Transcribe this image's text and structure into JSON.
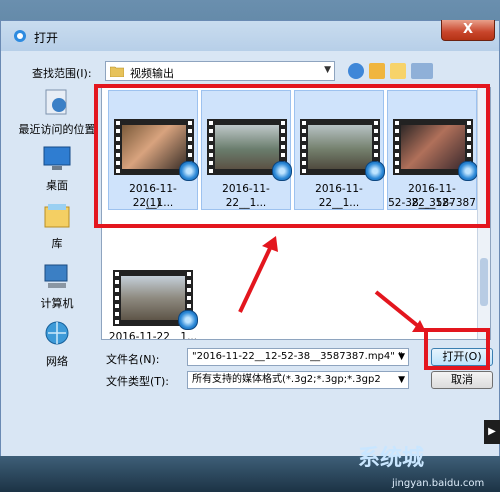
{
  "dialog": {
    "title": "打开",
    "close_glyph": "X"
  },
  "lookin": {
    "label": "查找范围(I):",
    "value": "视频输出"
  },
  "nav": [
    {
      "label": "最近访问的位置",
      "icon": "recent-places-icon"
    },
    {
      "label": "桌面",
      "icon": "desktop-icon"
    },
    {
      "label": "库",
      "icon": "libraries-icon"
    },
    {
      "label": "计算机",
      "icon": "computer-icon"
    },
    {
      "label": "网络",
      "icon": "network-icon"
    }
  ],
  "files": [
    {
      "line1": "2016-11-22__1...",
      "line2": "(1)",
      "selected": true
    },
    {
      "line1": "2016-11-22__1...",
      "line2": "",
      "selected": true
    },
    {
      "line1": "2016-11-22__1...",
      "line2": "",
      "selected": true
    },
    {
      "line1": "2016-11-22__12-",
      "line2": "52-38__3587387",
      "selected": true
    },
    {
      "line1": "2016-11-22__1...",
      "line2": "",
      "selected": false
    }
  ],
  "filename": {
    "label": "文件名(N):",
    "value": "\"2016-11-22__12-52-38__3587387.mp4\" \""
  },
  "filetype": {
    "label": "文件类型(T):",
    "value": "所有支持的媒体格式(*.3g2;*.3gp;*.3gp2"
  },
  "buttons": {
    "open": "打开(O)",
    "cancel": "取消"
  },
  "watermark": {
    "text": "系统城",
    "url": "jingyan.baidu.com"
  },
  "colors": {
    "highlight_red": "#e3161e",
    "selection": "#cfe3fb"
  }
}
